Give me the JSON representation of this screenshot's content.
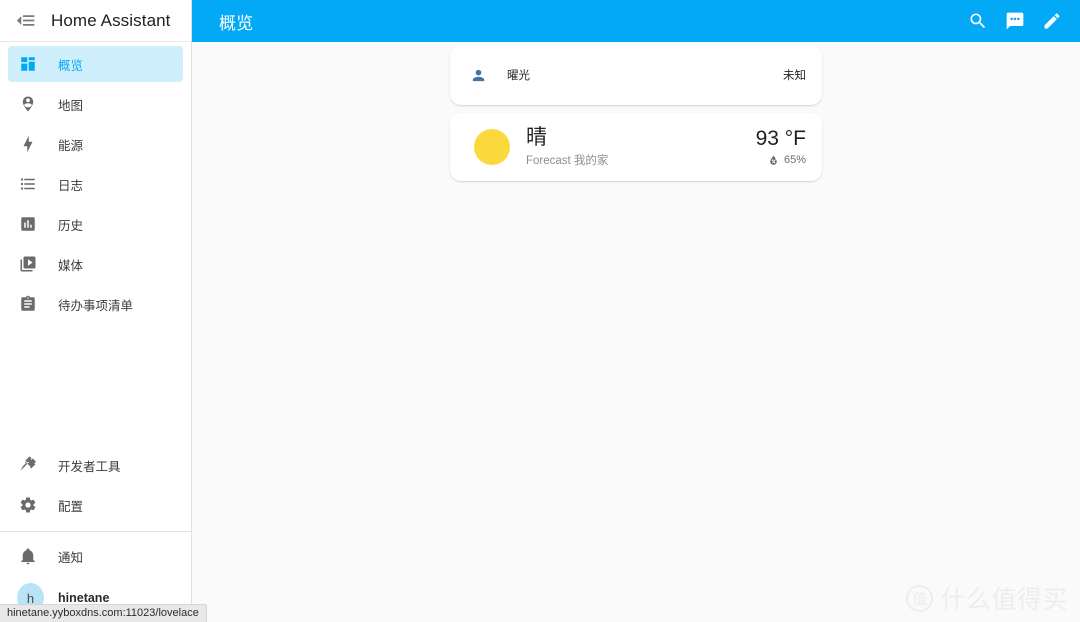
{
  "sidebar": {
    "menu_icon": "menu-open-icon",
    "title": "Home Assistant",
    "items": [
      {
        "label": "概览",
        "icon": "view-dashboard-icon",
        "active": true
      },
      {
        "label": "地图",
        "icon": "map-marker-account-icon",
        "active": false
      },
      {
        "label": "能源",
        "icon": "lightning-bolt-icon",
        "active": false
      },
      {
        "label": "日志",
        "icon": "format-list-bulleted-icon",
        "active": false
      },
      {
        "label": "历史",
        "icon": "chart-box-icon",
        "active": false
      },
      {
        "label": "媒体",
        "icon": "play-box-multiple-icon",
        "active": false
      },
      {
        "label": "待办事项清单",
        "icon": "clipboard-list-icon",
        "active": false
      }
    ],
    "bottom_items": [
      {
        "label": "开发者工具",
        "icon": "hammer-wrench-icon"
      },
      {
        "label": "配置",
        "icon": "cog-icon"
      }
    ],
    "notifications": {
      "label": "通知",
      "icon": "bell-icon"
    },
    "user": {
      "label": "hinetane",
      "initial": "h"
    }
  },
  "topbar": {
    "title": "概览",
    "actions": [
      {
        "name": "search-icon",
        "label": "搜索"
      },
      {
        "name": "assist-icon",
        "label": "Assist"
      },
      {
        "name": "edit-pencil-icon",
        "label": "编辑仪表板"
      }
    ]
  },
  "cards": {
    "entities_card": {
      "rows": [
        {
          "icon": "account-icon",
          "name": "曜光",
          "state": "未知"
        }
      ]
    },
    "weather_card": {
      "icon": "weather-sunny-icon",
      "condition": "晴",
      "subtitle": "Forecast 我的家",
      "temperature": "93 °F",
      "humidity_icon": "water-percent-icon",
      "humidity": "65%"
    }
  },
  "watermark": {
    "logo_char": "值",
    "text": "什么值得买"
  },
  "statusbar": {
    "url": "hinetane.yyboxdns.com:11023/lovelace"
  }
}
